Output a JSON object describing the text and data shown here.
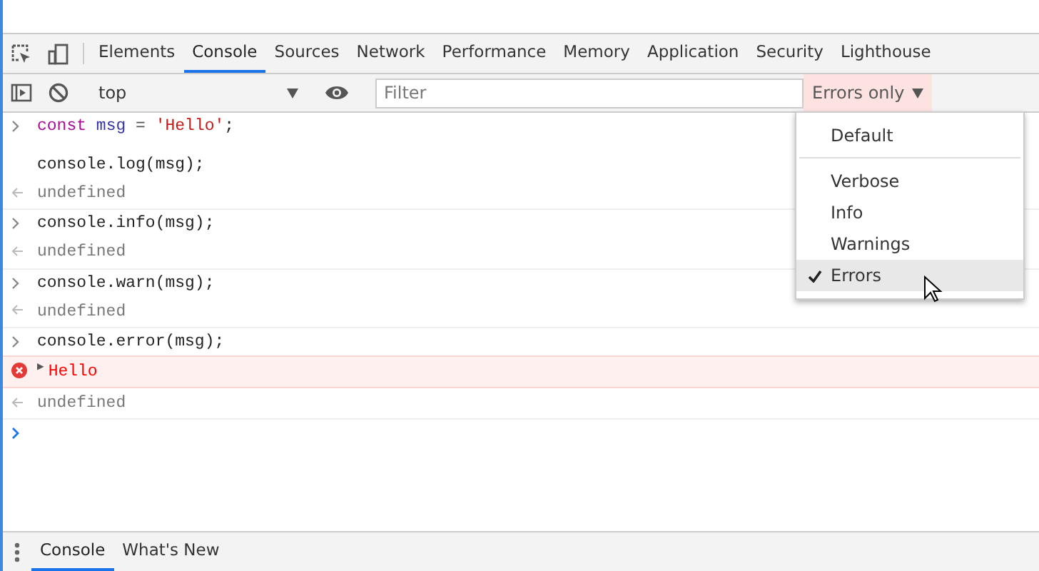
{
  "tabs": [
    {
      "label": "Elements",
      "selected": false
    },
    {
      "label": "Console",
      "selected": true
    },
    {
      "label": "Sources",
      "selected": false
    },
    {
      "label": "Network",
      "selected": false
    },
    {
      "label": "Performance",
      "selected": false
    },
    {
      "label": "Memory",
      "selected": false
    },
    {
      "label": "Application",
      "selected": false
    },
    {
      "label": "Security",
      "selected": false
    },
    {
      "label": "Lighthouse",
      "selected": false
    }
  ],
  "toolbar": {
    "context": "top",
    "filter": {
      "placeholder": "Filter"
    },
    "levels_button": "Errors only"
  },
  "entries": [
    {
      "kind": "input",
      "lines": [
        [
          {
            "text": "const ",
            "kind": "keyword"
          },
          {
            "text": "msg ",
            "kind": "variable"
          },
          {
            "text": "= ",
            "kind": "operator"
          },
          {
            "text": "'Hello'",
            "kind": "string"
          },
          {
            "text": ";",
            "kind": "plain"
          }
        ]
      ]
    },
    {
      "kind": "continuation",
      "lines": [
        [
          {
            "text": "console.log(msg);",
            "kind": "plain"
          }
        ]
      ]
    },
    {
      "kind": "result",
      "text": "undefined"
    },
    {
      "kind": "input",
      "lines": [
        [
          {
            "text": "console.info(msg);",
            "kind": "plain"
          }
        ]
      ]
    },
    {
      "kind": "result",
      "text": "undefined"
    },
    {
      "kind": "input",
      "lines": [
        [
          {
            "text": "console.warn(msg);",
            "kind": "plain"
          }
        ]
      ]
    },
    {
      "kind": "result",
      "text": "undefined"
    },
    {
      "kind": "input",
      "lines": [
        [
          {
            "text": "console.error(msg);",
            "kind": "plain"
          }
        ]
      ]
    },
    {
      "kind": "error",
      "expander": "▶",
      "text": "Hello"
    },
    {
      "kind": "result",
      "text": "undefined"
    },
    {
      "kind": "prompt"
    }
  ],
  "levels_menu": [
    {
      "kind": "option",
      "label": "Default",
      "selected": false
    },
    {
      "kind": "separator"
    },
    {
      "kind": "option",
      "label": "Verbose",
      "selected": false
    },
    {
      "kind": "option",
      "label": "Info",
      "selected": false
    },
    {
      "kind": "option",
      "label": "Warnings",
      "selected": false
    },
    {
      "kind": "option",
      "label": "Errors",
      "selected": true
    }
  ],
  "drawer_tabs": [
    {
      "label": "Console",
      "selected": true
    },
    {
      "label": "What's New",
      "selected": false
    }
  ]
}
